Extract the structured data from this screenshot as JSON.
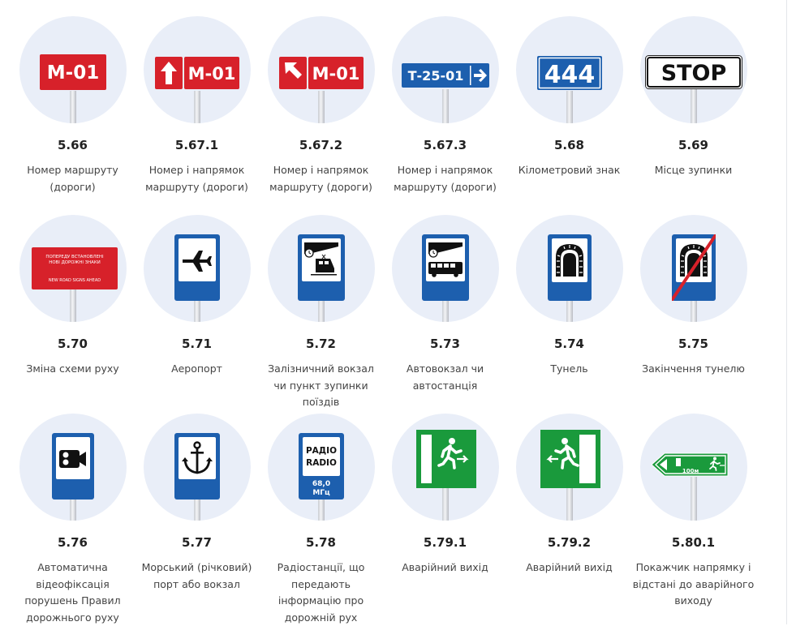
{
  "signs": [
    {
      "code": "5.66",
      "title": "Номер маршруту (дороги)",
      "sign_text": "М-01"
    },
    {
      "code": "5.67.1",
      "title": "Номер і напрямок маршруту (дороги)",
      "sign_text": "М-01"
    },
    {
      "code": "5.67.2",
      "title": "Номер і напрямок маршруту (дороги)",
      "sign_text": "М-01"
    },
    {
      "code": "5.67.3",
      "title": "Номер і напрямок маршруту (дороги)",
      "sign_text": "Т-25-01"
    },
    {
      "code": "5.68",
      "title": "Кілометровий знак",
      "sign_text": "444"
    },
    {
      "code": "5.69",
      "title": "Місце зупинки",
      "sign_text": "STOP"
    },
    {
      "code": "5.70",
      "title": "Зміна схеми руху",
      "sign_text": [
        "ПОПЕРЕДУ ВСТАНОВЛЕНІ",
        "НОВІ ДОРОЖНІ ЗНАКИ",
        "NEW ROAD SIGNS AHEAD"
      ]
    },
    {
      "code": "5.71",
      "title": "Аеропорт"
    },
    {
      "code": "5.72",
      "title": "Залізничний вокзал чи пункт зупинки поїздів"
    },
    {
      "code": "5.73",
      "title": "Автовокзал чи автостанція"
    },
    {
      "code": "5.74",
      "title": "Тунель"
    },
    {
      "code": "5.75",
      "title": "Закінчення тунелю"
    },
    {
      "code": "5.76",
      "title": "Автоматична відеофіксація порушень Правил дорожнього руху"
    },
    {
      "code": "5.77",
      "title": "Морський (річковий) порт або вокзал"
    },
    {
      "code": "5.78",
      "title": "Радіостанції, що передають інформацію про дорожній рух",
      "sign_text": [
        "РАДІО",
        "RADIO",
        "68,0",
        "МГц"
      ]
    },
    {
      "code": "5.79.1",
      "title": "Аварійний вихід"
    },
    {
      "code": "5.79.2",
      "title": "Аварійний вихід"
    },
    {
      "code": "5.80.1",
      "title": "Покажчик напрямку і відстані до аварійного виходу",
      "sign_text": "100м"
    }
  ],
  "colors": {
    "disc": "#e9eef8",
    "red": "#d7212a",
    "blue": "#1d5fae",
    "green": "#1a9a3c"
  }
}
